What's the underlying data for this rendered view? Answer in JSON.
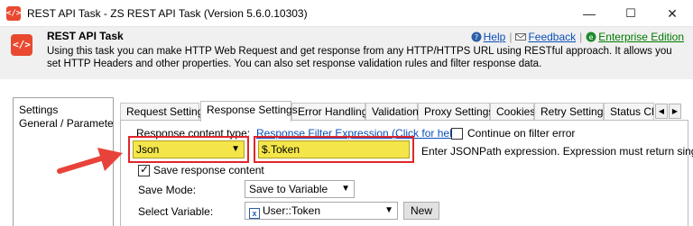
{
  "window": {
    "title": "REST API Task - ZS REST API Task (Version 5.6.0.10303)",
    "app_icon": "code-brackets-icon",
    "controls": {
      "minimize": "—",
      "maximize": "☐",
      "close": "✕"
    }
  },
  "header": {
    "title": "REST API Task",
    "description": "Using this task you can make HTTP Web Request and get response from any HTTP/HTTPS URL using RESTful approach. It allows you set HTTP Headers and other properties. You can also set response validation rules and filter response data.",
    "links": {
      "help": "Help",
      "feedback": "Feedback",
      "edition": "Enterprise Edition"
    }
  },
  "sidebar": {
    "items": [
      {
        "label": "Settings"
      },
      {
        "label": "General / Parameters"
      }
    ]
  },
  "tabs": [
    {
      "label": "Request Settings"
    },
    {
      "label": "Response Settings"
    },
    {
      "label": "Error Handling"
    },
    {
      "label": "Validation"
    },
    {
      "label": "Proxy Settings"
    },
    {
      "label": "Cookies"
    },
    {
      "label": "Retry Settings"
    },
    {
      "label": "Status Ch"
    }
  ],
  "active_tab": "Response Settings",
  "response": {
    "content_type_label": "Response content type:",
    "content_type_value": "Json",
    "filter_link": "Response Filter Expression (Click for help)",
    "filter_value": "$.Token",
    "continue_label": "Continue on filter error",
    "continue_checked": false,
    "hint": "Enter JSONPath expression. Expression must return single c",
    "save_label": "Save response content",
    "save_checked": true,
    "save_mode_label": "Save Mode:",
    "save_mode_value": "Save to Variable",
    "select_var_label": "Select Variable:",
    "variable_value": "User::Token",
    "new_button": "New"
  },
  "colors": {
    "highlight_yellow": "#f4e64a",
    "highlight_border": "#e0262b",
    "arrow": "#e8433a",
    "link": "#0b4fb8"
  }
}
